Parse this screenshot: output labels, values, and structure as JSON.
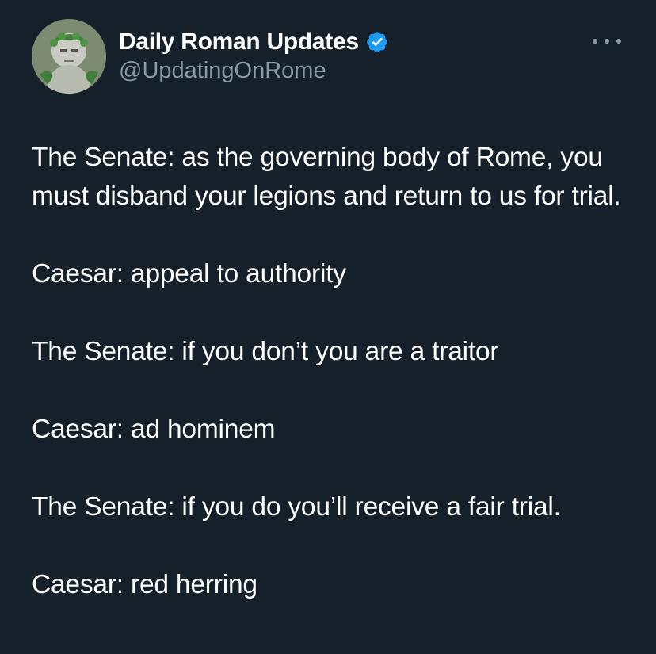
{
  "tweet": {
    "author": {
      "display_name": "Daily Roman Updates",
      "handle": "@UpdatingOnRome",
      "verified": true,
      "verified_color": "#1d9bf0",
      "avatar_icon": "roman-bust-avatar"
    },
    "more_icon": "ellipsis-icon",
    "paragraphs": [
      "The Senate: as the governing body of Rome, you must disband your legions and return to us for trial.",
      "Caesar: appeal to authority",
      "The Senate: if you don’t you are a traitor",
      "Caesar: ad hominem",
      "The Senate: if you do you’ll receive a fair trial.",
      "Caesar: red herring"
    ]
  },
  "colors": {
    "background": "#15202b",
    "text": "#ffffff",
    "secondary_text": "#8b98a5"
  }
}
